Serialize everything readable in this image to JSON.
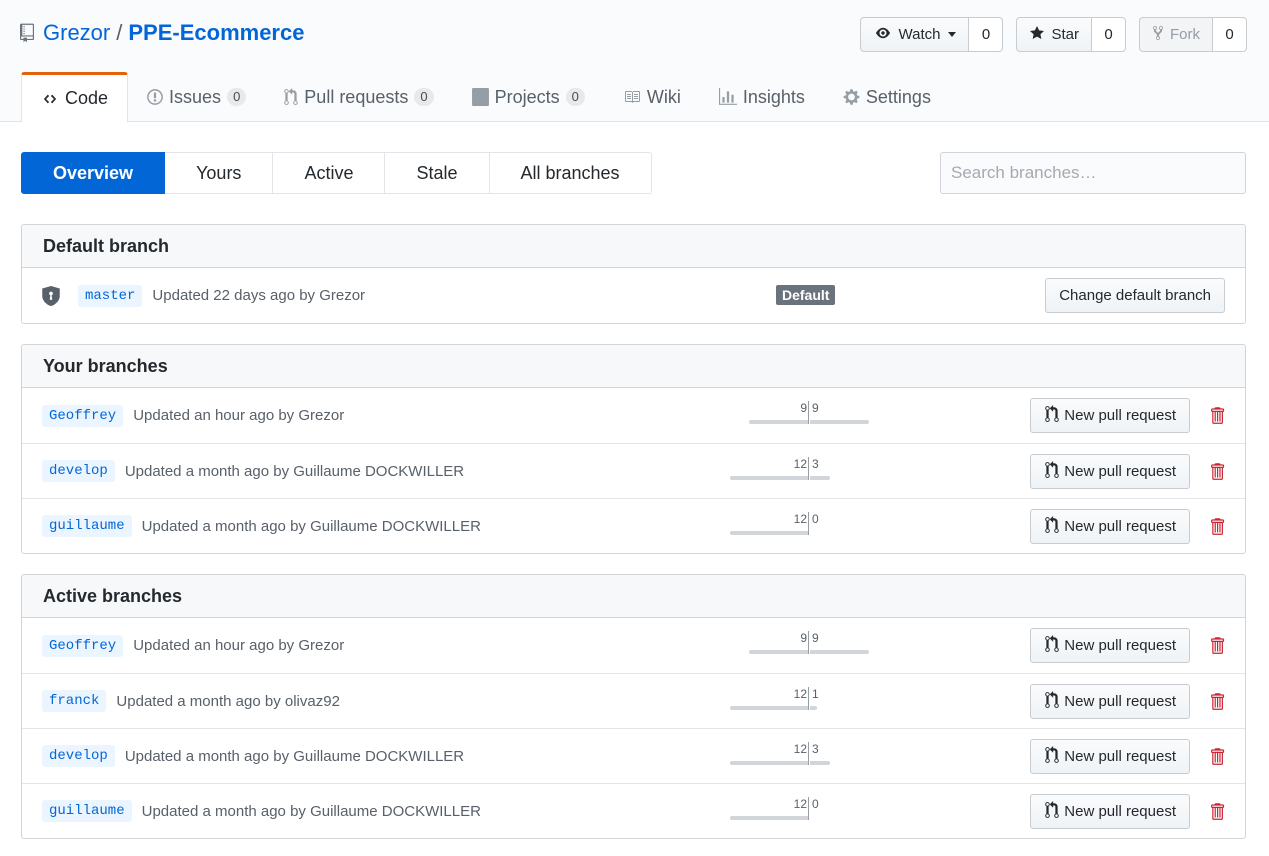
{
  "repo": {
    "owner": "Grezor",
    "separator": "/",
    "name": "PPE-Ecommerce"
  },
  "actions": {
    "watch": {
      "label": "Watch",
      "count": "0"
    },
    "star": {
      "label": "Star",
      "count": "0"
    },
    "fork": {
      "label": "Fork",
      "count": "0"
    }
  },
  "tabs": [
    {
      "label": "Code",
      "icon": "code-icon"
    },
    {
      "label": "Issues",
      "count": "0",
      "icon": "issue-icon"
    },
    {
      "label": "Pull requests",
      "count": "0",
      "icon": "pull-request-icon"
    },
    {
      "label": "Projects",
      "count": "0",
      "icon": "project-icon"
    },
    {
      "label": "Wiki",
      "icon": "book-icon"
    },
    {
      "label": "Insights",
      "icon": "graph-icon"
    },
    {
      "label": "Settings",
      "icon": "gear-icon"
    }
  ],
  "subnav": [
    "Overview",
    "Yours",
    "Active",
    "Stale",
    "All branches"
  ],
  "search": {
    "placeholder": "Search branches…"
  },
  "default_section": {
    "title": "Default branch",
    "branch": "master",
    "meta": "Updated 22 days ago by Grezor",
    "badge": "Default",
    "button": "Change default branch"
  },
  "new_pr_label": "New pull request",
  "your_section": {
    "title": "Your branches",
    "rows": [
      {
        "branch": "Geoffrey",
        "meta": "Updated an hour ago by Grezor",
        "behind": "9",
        "ahead": "9"
      },
      {
        "branch": "develop",
        "meta": "Updated a month ago by Guillaume DOCKWILLER",
        "behind": "12",
        "ahead": "3"
      },
      {
        "branch": "guillaume",
        "meta": "Updated a month ago by Guillaume DOCKWILLER",
        "behind": "12",
        "ahead": "0"
      }
    ]
  },
  "active_section": {
    "title": "Active branches",
    "rows": [
      {
        "branch": "Geoffrey",
        "meta": "Updated an hour ago by Grezor",
        "behind": "9",
        "ahead": "9"
      },
      {
        "branch": "franck",
        "meta": "Updated a month ago by olivaz92",
        "behind": "12",
        "ahead": "1"
      },
      {
        "branch": "develop",
        "meta": "Updated a month ago by Guillaume DOCKWILLER",
        "behind": "12",
        "ahead": "3"
      },
      {
        "branch": "guillaume",
        "meta": "Updated a month ago by Guillaume DOCKWILLER",
        "behind": "12",
        "ahead": "0"
      }
    ]
  }
}
